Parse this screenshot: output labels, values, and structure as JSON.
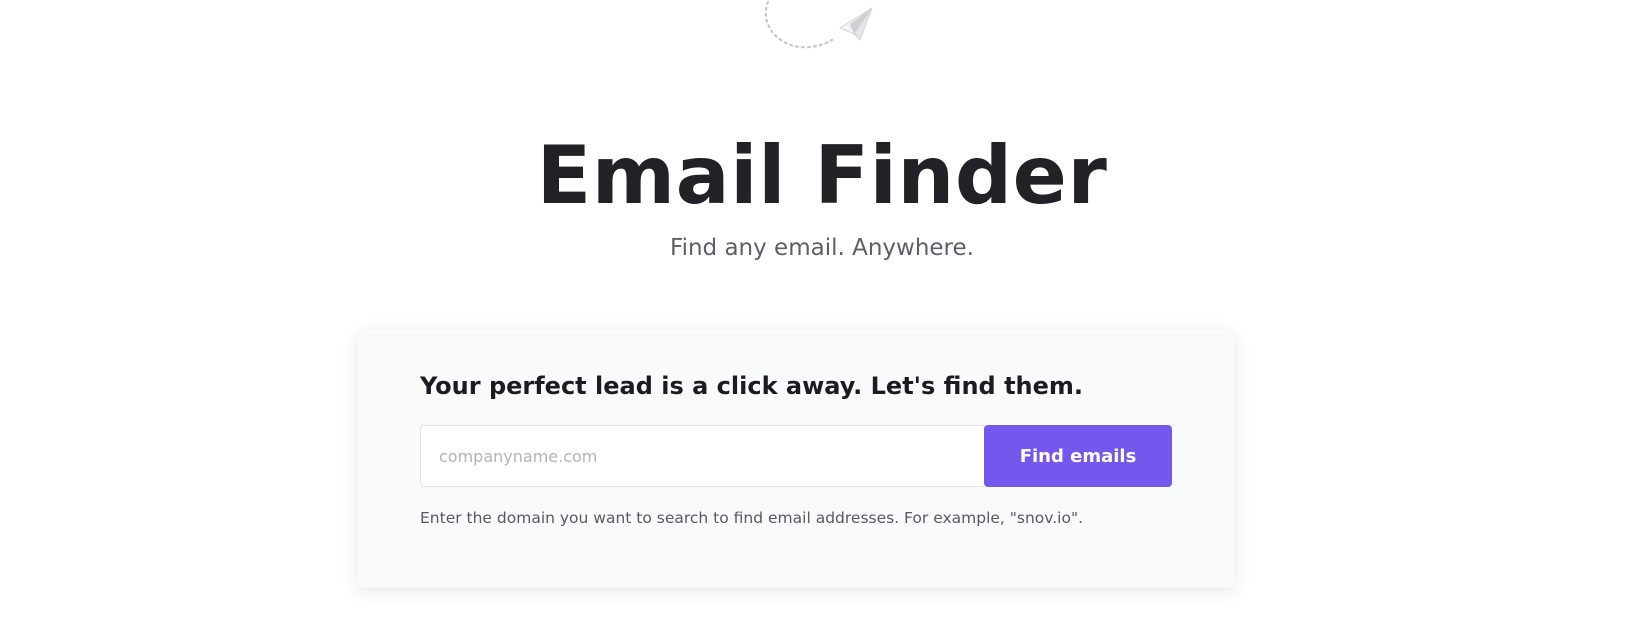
{
  "hero": {
    "title": "Email Finder",
    "subtitle": "Find any email. Anywhere."
  },
  "search_card": {
    "heading": "Your perfect lead is a click away. Let's find them.",
    "input": {
      "value": "",
      "placeholder": "companyname.com"
    },
    "button_label": "Find emails",
    "hint": "Enter the domain you want to search to find email addresses. For example, \"snov.io\"."
  },
  "colors": {
    "accent": "#7557ee",
    "title": "#222226",
    "subtitle": "#5f5c6c",
    "card_background": "#f9fafa"
  },
  "icons": {
    "decoration": "paper-plane-icon"
  }
}
